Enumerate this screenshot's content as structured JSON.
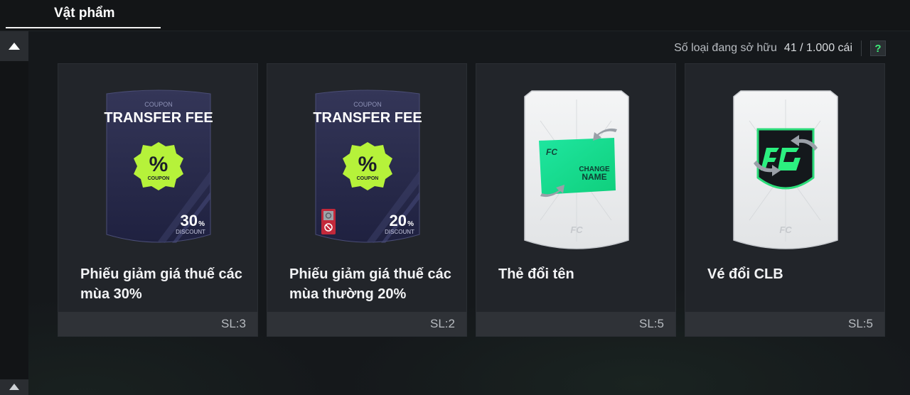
{
  "tabs": {
    "active_label": "Vật phẩm"
  },
  "status": {
    "owned_label": "Số loại đang sở hữu",
    "owned_count": "41 / 1.000 cái",
    "help_label": "?"
  },
  "cards": [
    {
      "name": "Phiếu giảm giá thuế các mùa 30%",
      "qty": "SL:3",
      "art": {
        "kind": "coupon",
        "coupon_small": "COUPON",
        "coupon_title": "TRANSFER FEE",
        "badge_symbol": "%",
        "badge_sub": "COUPON",
        "discount_value": "30",
        "discount_unit": "%",
        "discount_label": "DISCOUNT",
        "restricted": false
      }
    },
    {
      "name": "Phiếu giảm giá thuế các mùa thường 20%",
      "qty": "SL:2",
      "art": {
        "kind": "coupon",
        "coupon_small": "COUPON",
        "coupon_title": "TRANSFER FEE",
        "badge_symbol": "%",
        "badge_sub": "COUPON",
        "discount_value": "20",
        "discount_unit": "%",
        "discount_label": "DISCOUNT",
        "restricted": true
      }
    },
    {
      "name": "Thẻ đổi tên",
      "qty": "SL:5",
      "art": {
        "kind": "rename",
        "ticket_line1": "CHANGE",
        "ticket_line2": "NAME"
      }
    },
    {
      "name": "Vé đổi CLB",
      "qty": "SL:5",
      "art": {
        "kind": "club"
      }
    }
  ],
  "colors": {
    "accent_green": "#3ef07a",
    "coupon_badge": "#b6f23a",
    "coupon_bg": "#2a2c4a"
  }
}
